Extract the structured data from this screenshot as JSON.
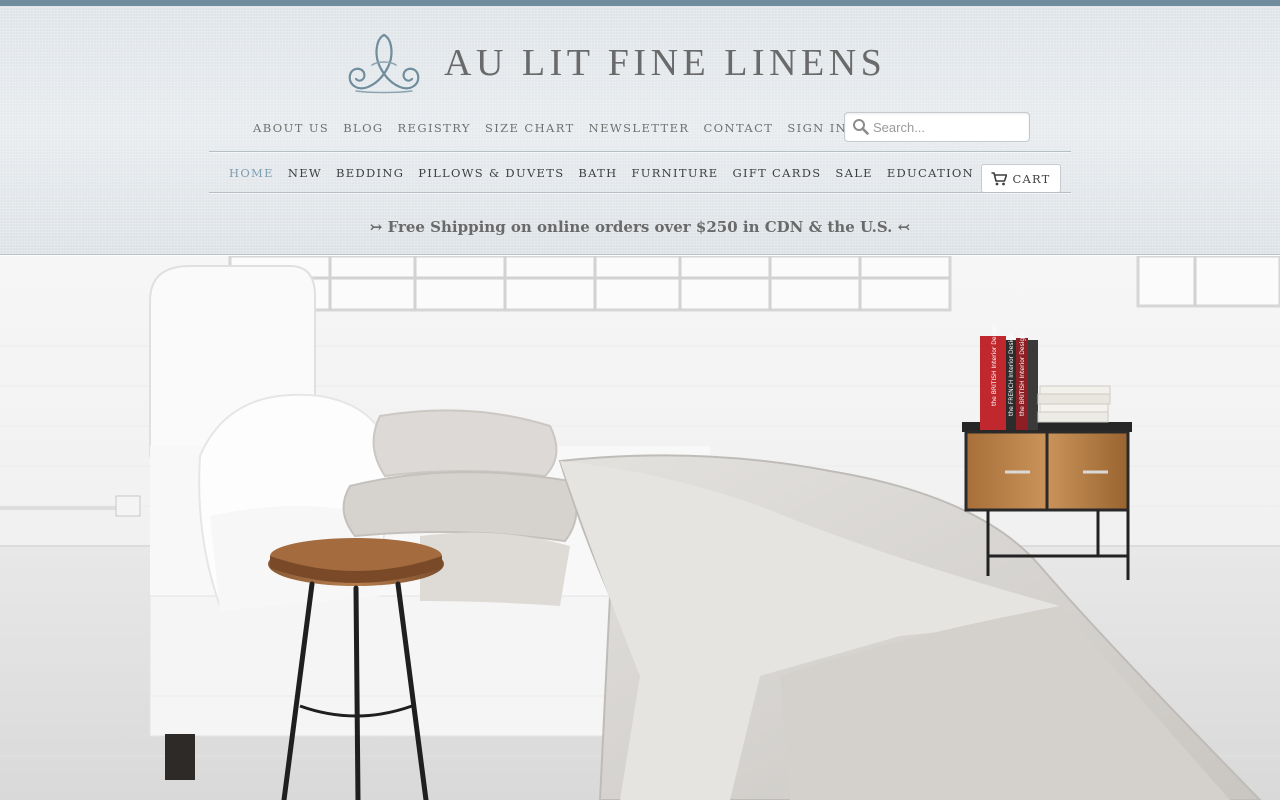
{
  "brand": {
    "name": "AU LIT FINE LINENS",
    "logo_icon": "script-monogram-icon",
    "colors": {
      "top_strip": "#6f8d9c",
      "accent": "#7f9fb0",
      "text": "#3f3f3f",
      "muted": "#707070"
    }
  },
  "utility_nav": [
    {
      "label": "ABOUT US"
    },
    {
      "label": "BLOG"
    },
    {
      "label": "REGISTRY"
    },
    {
      "label": "SIZE CHART"
    },
    {
      "label": "NEWSLETTER"
    },
    {
      "label": "CONTACT"
    },
    {
      "label": "SIGN IN"
    }
  ],
  "search": {
    "placeholder": "Search...",
    "value": "",
    "icon": "search-icon"
  },
  "main_nav": [
    {
      "label": "HOME",
      "active": true
    },
    {
      "label": "NEW"
    },
    {
      "label": "BEDDING"
    },
    {
      "label": "PILLOWS & DUVETS"
    },
    {
      "label": "BATH"
    },
    {
      "label": "FURNITURE"
    },
    {
      "label": "GIFT CARDS"
    },
    {
      "label": "SALE"
    },
    {
      "label": "EDUCATION"
    }
  ],
  "cart": {
    "label": "CART",
    "icon": "cart-icon"
  },
  "promo": {
    "text": "↣ Free Shipping on online orders over $250 in CDN & the U.S. ↢"
  },
  "hero": {
    "book_spines": [
      "the BRITISH Interior Design",
      "the FRENCH Interior Design",
      "the BRITISH Interior Design"
    ]
  }
}
